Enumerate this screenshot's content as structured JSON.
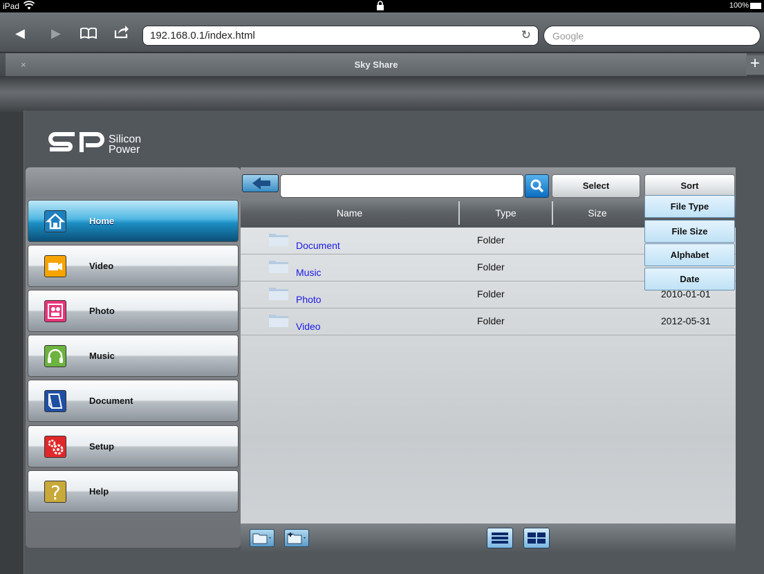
{
  "status_bar": {
    "device": "iPad",
    "battery_percent": "100%"
  },
  "browser": {
    "url": "192.168.0.1/index.html",
    "search_placeholder": "Google",
    "tab_title": "Sky Share",
    "tab_close": "×",
    "tab_add": "+"
  },
  "logo": {
    "brand_line1": "Silicon",
    "brand_line2": "Power"
  },
  "sidebar": {
    "items": [
      {
        "label": "Home",
        "icon": "home-icon",
        "color": "#1b7fc0",
        "active": true
      },
      {
        "label": "Video",
        "icon": "video-icon",
        "color": "#f5a400"
      },
      {
        "label": "Photo",
        "icon": "photo-icon",
        "color": "#e8357b"
      },
      {
        "label": "Music",
        "icon": "music-icon",
        "color": "#6cb33f"
      },
      {
        "label": "Document",
        "icon": "document-icon",
        "color": "#1e4fa3"
      },
      {
        "label": "Setup",
        "icon": "setup-icon",
        "color": "#e0282b"
      },
      {
        "label": "Help",
        "icon": "help-icon",
        "color": "#c9a93a"
      }
    ]
  },
  "toolbar": {
    "select_label": "Select",
    "sort_label": "Sort"
  },
  "table": {
    "headers": {
      "name": "Name",
      "type": "Type",
      "size": "Size"
    },
    "rows": [
      {
        "name": "Document",
        "type": "Folder",
        "date": ""
      },
      {
        "name": "Music",
        "type": "Folder",
        "date": ""
      },
      {
        "name": "Photo",
        "type": "Folder",
        "date": "2010-01-01"
      },
      {
        "name": "Video",
        "type": "Folder",
        "date": "2012-05-31"
      }
    ]
  },
  "sort_menu": {
    "options": [
      "File Type",
      "File Size",
      "Alphabet",
      "Date"
    ]
  }
}
